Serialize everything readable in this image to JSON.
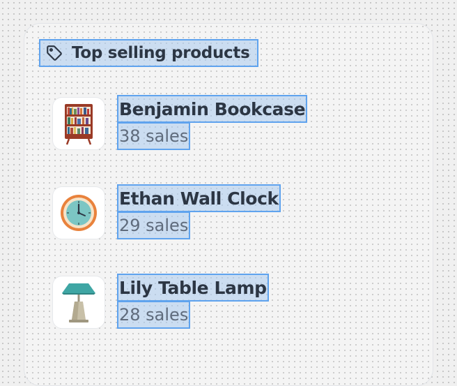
{
  "card": {
    "title": "Top selling products",
    "title_icon": "tag-icon"
  },
  "products": [
    {
      "name": "Benjamin Bookcase",
      "sales": "38 sales",
      "image": "bookcase-image"
    },
    {
      "name": "Ethan Wall Clock",
      "sales": "29 sales",
      "image": "wall-clock-image"
    },
    {
      "name": "Lily Table Lamp",
      "sales": "28 sales",
      "image": "table-lamp-image"
    }
  ],
  "colors": {
    "text_primary": "#2c3644",
    "text_secondary": "#5f6b7c",
    "highlight_border": "#5fa3ee"
  }
}
